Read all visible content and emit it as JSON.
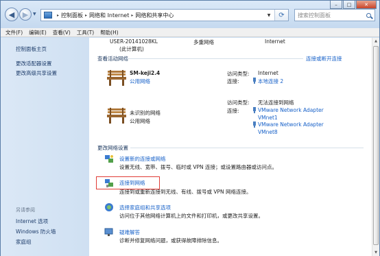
{
  "address": {
    "crumbs": [
      "控制面板",
      "网络和 Internet",
      "网络和共享中心"
    ]
  },
  "search": {
    "placeholder": "搜索控制面板"
  },
  "menu": [
    "文件(F)",
    "编辑(E)",
    "查看(V)",
    "工具(T)",
    "帮助(H)"
  ],
  "left_pane": {
    "links": [
      "控制面板主页",
      "更改适配器设置",
      "更改高级共享设置"
    ],
    "see_also_title": "另请参阅",
    "see_also": [
      "Internet 选项",
      "Windows 防火墙",
      "家庭组"
    ]
  },
  "top_map": {
    "computer": "USER-20141028KL",
    "computer_sub": "(此计算机)",
    "multi_network": "多重网络",
    "internet": "Internet"
  },
  "active_networks": {
    "heading": "查看活动网络",
    "connect_disconnect": "连接或断开连接",
    "networks": [
      {
        "name": "SM-keji2.4",
        "type": "公用网络",
        "access_label": "访问类型:",
        "access_value": "Internet",
        "conn_label": "连接:",
        "conn_values": [
          "本地连接 2"
        ]
      },
      {
        "name": "未识别的网络",
        "type": "公用网络",
        "access_label": "访问类型:",
        "access_value": "无法连接到网络",
        "conn_label": "连接:",
        "conn_values": [
          "VMware Network Adapter",
          "VMnet1",
          "VMware Network Adapter",
          "VMnet8"
        ]
      }
    ]
  },
  "change_settings": {
    "heading": "更改网络设置",
    "tasks": [
      {
        "title": "设置新的连接或网络",
        "desc": "设置无线、宽带、拨号、临时或 VPN 连接；或设置路由器或访问点。"
      },
      {
        "title": "连接到网络",
        "desc": "连接到或重新连接到无线、有线、拨号或 VPN 网络连接。"
      },
      {
        "title": "选择家庭组和共享选项",
        "desc": "访问位于其他网络计算机上的文件和打印机，或更改共享设置。"
      },
      {
        "title": "疑难解答",
        "desc": "诊断并修复网络问题，或获得故障排除信息。"
      }
    ]
  },
  "colors": {
    "link": "#1660c8",
    "left_pane": "#d6e5f5",
    "highlight": "#e03b35"
  }
}
